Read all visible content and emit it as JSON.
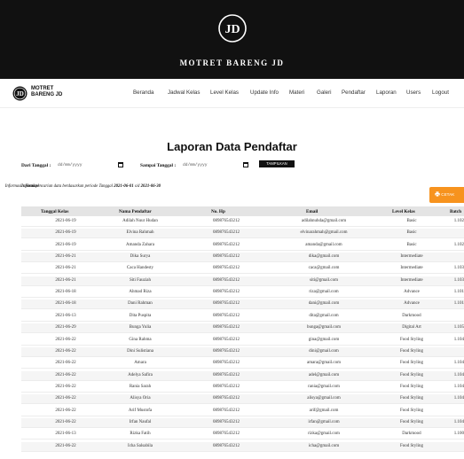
{
  "hero": {
    "logo_text": "JD",
    "title": "MOTRET BARENG JD"
  },
  "brand": {
    "line1": "MOTRET",
    "line2": "BARENG JD"
  },
  "nav": [
    "Beranda",
    "Jadwal Kelas",
    "Level Kelas",
    "Update Info",
    "Materi",
    "Galeri",
    "Pendaftar",
    "Laporan",
    "Users",
    "Logout"
  ],
  "page_title": "Laporan Data Pendaftar",
  "filter": {
    "from_label": "Dari Tanggal :",
    "to_label": "Sampai Tanggal :",
    "date_placeholder": "dd/mm/yyyy",
    "submit_label": "TAMPILKAN"
  },
  "info": {
    "prefix": "Informasi : Hasil pencarian data berdasarkan periode Tanggal",
    "from_date": "2021-06-01",
    "separator": "s/d",
    "to_date": "2021-06-30"
  },
  "print_button": "CETAK",
  "table": {
    "columns": [
      "Tanggal Kelas",
      "Nama Pendaftar",
      "No. Hp",
      "Email",
      "Level Kelas",
      "Batch"
    ],
    "rows": [
      [
        "2021-06-19",
        "Adilah Nuur Hudan",
        "089876543212",
        "adilahnuhda@gmail.com",
        "Basic",
        "1.102"
      ],
      [
        "2021-06-19",
        "Elvina Rahmah",
        "089876543212",
        "elvinarahmah@gmail.com",
        "Basic",
        ""
      ],
      [
        "2021-06-19",
        "Amanda Zahara",
        "089876543212",
        "amanda@gmail.com",
        "Basic",
        "1.102"
      ],
      [
        "2021-06-21",
        "Dika Surya",
        "089876543212",
        "dika@gmail.com",
        "Intermediate",
        ""
      ],
      [
        "2021-06-21",
        "Caca Handesty",
        "089876543212",
        "caca@gmail.com",
        "Intermediate",
        "1.103"
      ],
      [
        "2021-06-21",
        "Siti Fauziah",
        "089876543212",
        "siti@gmail.com",
        "Intermediate",
        "1.103"
      ],
      [
        "2021-06-18",
        "Ahmad Riza",
        "089876543212",
        "riza@gmail.com",
        "Advance",
        "1.101"
      ],
      [
        "2021-06-18",
        "Dani Rahman",
        "089876543212",
        "dani@gmail.com",
        "Advance",
        "1.101"
      ],
      [
        "2021-06-13",
        "Dita Puspita",
        "089876543212",
        "dita@gmail.com",
        "Darkmood",
        ""
      ],
      [
        "2021-06-29",
        "Bunga Yulia",
        "089876543212",
        "bunga@gmail.com",
        "Digital Art",
        "1.105"
      ],
      [
        "2021-06-22",
        "Gina Rahma",
        "089876543212",
        "gina@gmail.com",
        "Food Styling",
        "1.104"
      ],
      [
        "2021-06-22",
        "Dini Sulistiana",
        "089876543212",
        "dini@gmail.com",
        "Food Styling",
        ""
      ],
      [
        "2021-06-22",
        "Amara",
        "089876543212",
        "amara@gmail.com",
        "Food Styling",
        "1.104"
      ],
      [
        "2021-06-22",
        "Adelya Safira",
        "089876543212",
        "adel@gmail.com",
        "Food Styling",
        "1.104"
      ],
      [
        "2021-06-22",
        "Rania Sarah",
        "089876543212",
        "rania@gmail.com",
        "Food Styling",
        "1.104"
      ],
      [
        "2021-06-22",
        "Alisya Oria",
        "089876543212",
        "alisya@gmail.com",
        "Food Styling",
        "1.104"
      ],
      [
        "2021-06-22",
        "Arif Mustofa",
        "089876543212",
        "arif@gmail.com",
        "Food Styling",
        ""
      ],
      [
        "2021-06-22",
        "Irfan Naufal",
        "089876543212",
        "irfan@gmail.com",
        "Food Styling",
        "1.104"
      ],
      [
        "2021-06-13",
        "Rizka Fatih",
        "089876543212",
        "rizka@gmail.com",
        "Darkmood",
        "1.100"
      ],
      [
        "2021-06-22",
        "Icha Salsabila",
        "089876543212",
        "icha@gmail.com",
        "Food Styling",
        ""
      ]
    ]
  }
}
